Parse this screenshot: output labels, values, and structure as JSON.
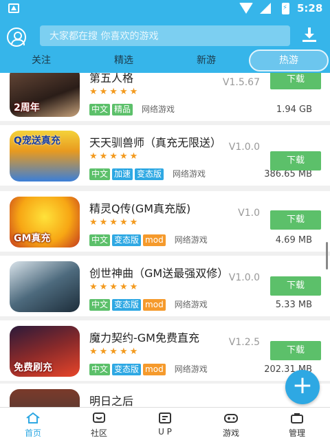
{
  "status_bar": {
    "time": "5:28"
  },
  "header": {
    "search_placeholder": "大家都在搜  你喜欢的游戏",
    "tabs": [
      {
        "label": "关注",
        "active": false
      },
      {
        "label": "精选",
        "active": false
      },
      {
        "label": "新游",
        "active": false
      },
      {
        "label": "热游",
        "active": true
      }
    ]
  },
  "games": [
    {
      "name": "第五人格",
      "rating_stars": 5,
      "stars": "★★★★★",
      "tags": [
        "中文",
        "精品"
      ],
      "category": "网络游戏",
      "version": "V1.5.67",
      "size": "1.94 GB",
      "download_label": "下载",
      "icon_caption": "2周年"
    },
    {
      "name": "天天驯兽师（真充无限送）",
      "rating_stars": 5,
      "stars": "★★★★★",
      "tags": [
        "中文",
        "加速",
        "变态版"
      ],
      "category": "网络游戏",
      "version": "V1.0.0",
      "size": "386.65 MB",
      "download_label": "下载",
      "icon_caption": "Q宠送真充"
    },
    {
      "name": "精灵Q传(GM真充版)",
      "rating_stars": 5,
      "stars": "★★★★★",
      "tags": [
        "中文",
        "变态版",
        "mod"
      ],
      "category": "网络游戏",
      "version": "V1.0",
      "size": "4.69 MB",
      "download_label": "下载",
      "icon_caption": "GM真充"
    },
    {
      "name": "创世神曲（GM送最强双修）",
      "rating_stars": 5,
      "stars": "★★★★★",
      "tags": [
        "中文",
        "变态版",
        "mod"
      ],
      "category": "网络游戏",
      "version": "V1.0.0",
      "size": "5.33 MB",
      "download_label": "下载",
      "icon_caption": ""
    },
    {
      "name": "魔力契约-GM免费直充",
      "rating_stars": 5,
      "stars": "★★★★★",
      "tags": [
        "中文",
        "变态版",
        "mod"
      ],
      "category": "网络游戏",
      "version": "V1.2.5",
      "size": "202.31 MB",
      "download_label": "下载",
      "icon_caption": "免费刷充"
    },
    {
      "name": "明日之后",
      "rating_stars": 0,
      "stars": "",
      "tags": [],
      "category": "",
      "version": "",
      "size": "",
      "download_label": "",
      "icon_caption": ""
    }
  ],
  "tag_colors": {
    "中文": "#5cc06a",
    "精品": "#5cc06a",
    "加速": "#2ea8e3",
    "变态版": "#2ea8e3",
    "mod": "#f59a2c"
  },
  "fab_label": "+",
  "bottom_nav": [
    {
      "label": "首页",
      "icon": "home-icon",
      "active": true
    },
    {
      "label": "社区",
      "icon": "community-icon",
      "active": false
    },
    {
      "label": "U P",
      "icon": "up-icon",
      "active": false
    },
    {
      "label": "游戏",
      "icon": "gamepad-icon",
      "active": false
    },
    {
      "label": "管理",
      "icon": "manage-icon",
      "active": false
    }
  ],
  "colors": {
    "primary": "#36b5ea",
    "download_button": "#5cc06a",
    "star": "#f39a1e"
  }
}
